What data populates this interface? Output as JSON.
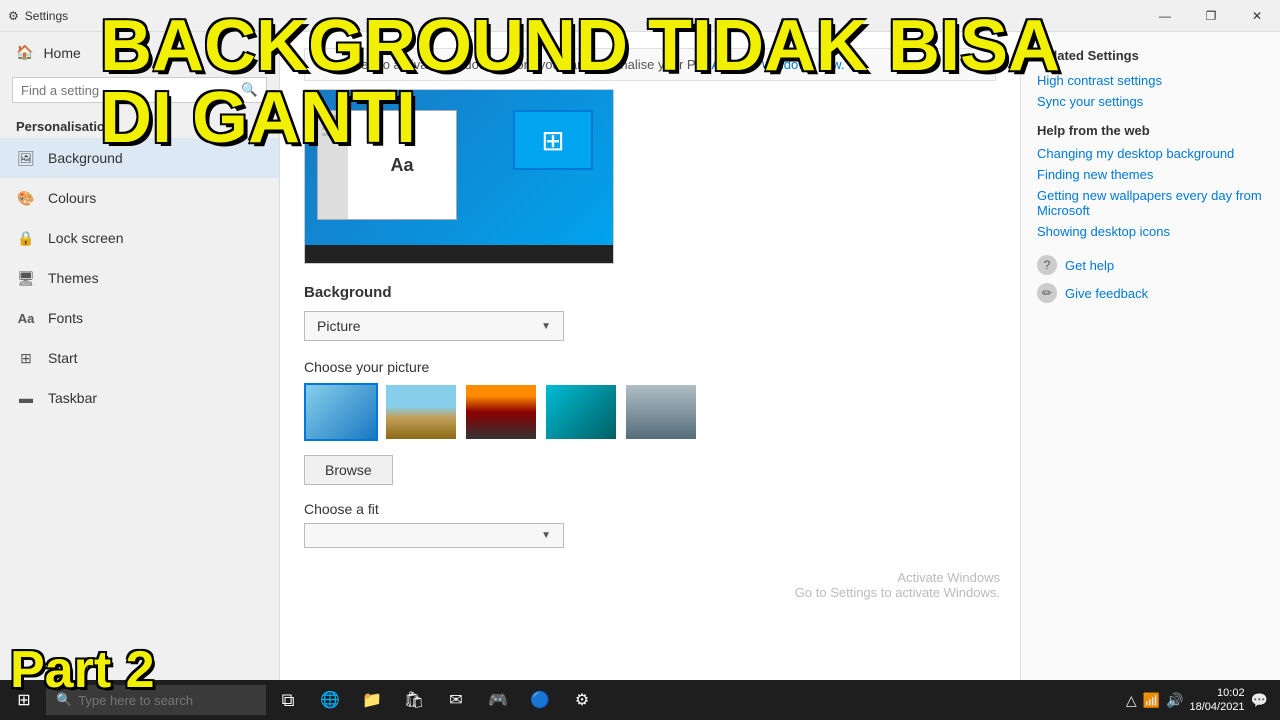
{
  "titleBar": {
    "title": "Settings",
    "controls": {
      "minimize": "—",
      "maximize": "❐",
      "close": "✕"
    }
  },
  "sidebar": {
    "home_label": "Home",
    "search_placeholder": "Find a setting",
    "section_label": "Personalisation",
    "items": [
      {
        "id": "background",
        "label": "Background",
        "icon": "🖼"
      },
      {
        "id": "colours",
        "label": "Colours",
        "icon": "🎨"
      },
      {
        "id": "lock-screen",
        "label": "Lock screen",
        "icon": "🔒"
      },
      {
        "id": "themes",
        "label": "Themes",
        "icon": "🖥"
      },
      {
        "id": "fonts",
        "label": "Fonts",
        "icon": "Aa"
      },
      {
        "id": "start",
        "label": "Start",
        "icon": "⊞"
      },
      {
        "id": "taskbar",
        "label": "Taskbar",
        "icon": "▬"
      }
    ]
  },
  "content": {
    "activate_message": "You need to activate Windows before you can personalise your PC.",
    "activate_link": "Activate Windows now.",
    "background_label": "Background",
    "dropdown_value": "Picture",
    "choose_picture_label": "Choose your picture",
    "browse_label": "Browse",
    "choose_fit_label": "Choose a fit"
  },
  "rightPanel": {
    "related_settings_title": "Related Settings",
    "related_links": [
      "High contrast settings",
      "Sync your settings"
    ],
    "help_title": "Help from the web",
    "help_links": [
      "Changing my desktop background",
      "Finding new themes",
      "Getting new wallpapers every day from Microsoft",
      "Showing desktop icons"
    ],
    "bottom_links": [
      {
        "icon": "?",
        "label": "Get help"
      },
      {
        "icon": "✏",
        "label": "Give feedback"
      }
    ]
  },
  "overlay": {
    "main_title": "BACKGROUND TIDAK BISA\nDI GANTI",
    "part_label": "Part 2"
  },
  "watermark": {
    "line1": "Activate Windows",
    "line2": "Go to Settings to activate Windows."
  },
  "taskbar": {
    "search_placeholder": "Type here to search",
    "time": "10:02",
    "date": "18/04/2021"
  }
}
